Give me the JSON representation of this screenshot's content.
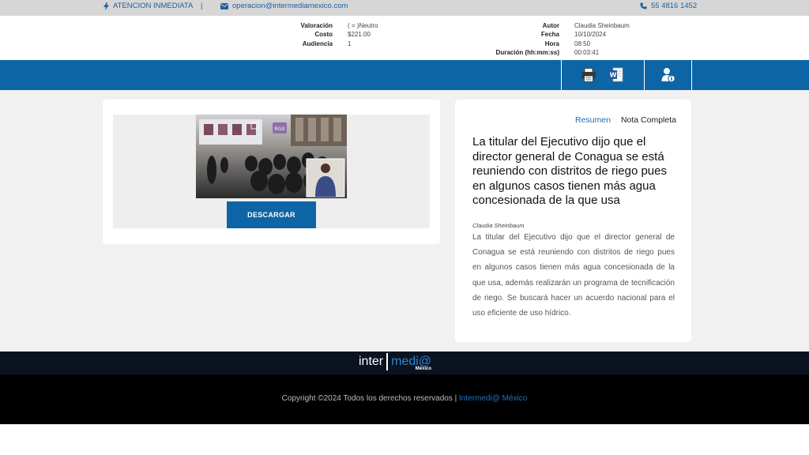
{
  "topbar": {
    "alert_label": "ATENCION INMEDIATA",
    "separator": "|",
    "email": "operacion@intermediamexico.com",
    "phone": "55 4816 1452"
  },
  "meta": {
    "valoracion_label": "Valoración",
    "valoracion_value": "( = )Neutro",
    "costo_label": "Costo",
    "costo_value": "$221.00",
    "audiencia_label": "Audiencia",
    "audiencia_value": "1",
    "autor_label": "Autor",
    "autor_value": "Claudia Sheinbaum",
    "fecha_label": "Fecha",
    "fecha_value": "10/10/2024",
    "hora_label": "Hora",
    "hora_value": "08:50",
    "duracion_label": "Duración (hh:mm:ss)",
    "duracion_value": "00:03:41"
  },
  "toolbar": {
    "print_icon": "printer-icon",
    "word_icon": "word-document-icon",
    "user_icon": "user-info-icon"
  },
  "media": {
    "thumb_badge": "RGX",
    "download_label": "DESCARGAR"
  },
  "article": {
    "tabs": [
      "Resumen",
      "Nota Completa"
    ],
    "headline": "La titular del Ejecutivo dijo que el director general de Conagua se está reuniendo con distritos de riego pues en algunos casos tienen más agua concesionada de la que usa",
    "author": "Claudia Sheinbaum",
    "body": "La titular del Ejecutivo dijo que el director general de Conagua se está reuniendo con distritos de riego pues en algunos casos tienen más agua concesionada de la que usa, además realizarán un programa de tecnificación de riego. Se buscará hacer un acuerdo nacional para el uso eficiente de uso hídrico."
  },
  "footer": {
    "logo_inter": "inter",
    "logo_media": "medi@",
    "logo_mexico": "México",
    "copyright": "Copyright ©2024 Todos los derechos reservados | ",
    "brand_link": "Intermedi@ México"
  },
  "colors": {
    "primary_blue": "#0d65a6",
    "link_blue": "#1d6fb5",
    "topbar_gray": "#d6d6d6",
    "content_gray": "#f1f1f1"
  }
}
